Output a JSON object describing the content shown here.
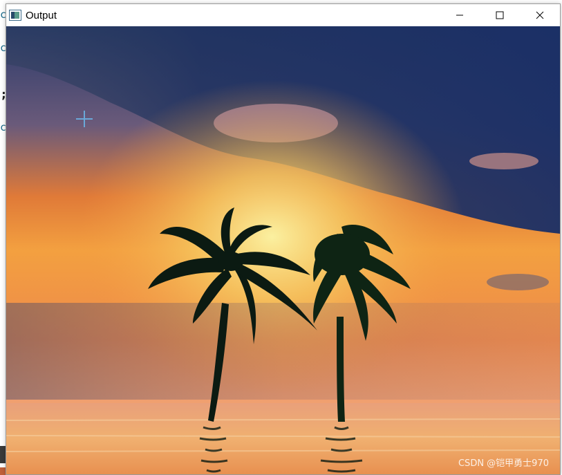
{
  "window": {
    "title": "Output",
    "controls": [
      "minimize-icon",
      "maximize-icon",
      "close-icon"
    ]
  },
  "background_editor": {
    "fragments": [
      "c",
      "c",
      ";",
      "c"
    ]
  },
  "image": {
    "subject": "two palm tree silhouettes against sunset sky over water",
    "watermark": "CSDN @铠甲勇士970"
  },
  "colors": {
    "sky_top": "#1e3a6e",
    "sky_mid": "#f08a30",
    "sun_glow": "#f7e07a",
    "water": "#e89a5a",
    "cursor": "#6aa8d8"
  }
}
